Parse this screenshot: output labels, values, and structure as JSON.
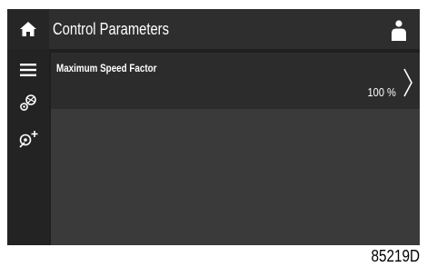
{
  "header": {
    "title": "Control Parameters",
    "home_icon": "home-icon",
    "user_icon": "user-icon"
  },
  "sidebar": {
    "items": [
      {
        "icon": "menu-icon"
      },
      {
        "icon": "gears-icon"
      },
      {
        "icon": "settings-add-icon"
      }
    ]
  },
  "parameters": [
    {
      "label": "Maximum Speed Factor",
      "value": "100 %"
    }
  ],
  "figure_code": "85219D",
  "colors": {
    "screen_bg": "#1f1f1f",
    "header_bg": "#2e2e2e",
    "content_bg": "#3a3a3a",
    "row_bg": "#2c2c2c",
    "text": "#ffffff"
  }
}
